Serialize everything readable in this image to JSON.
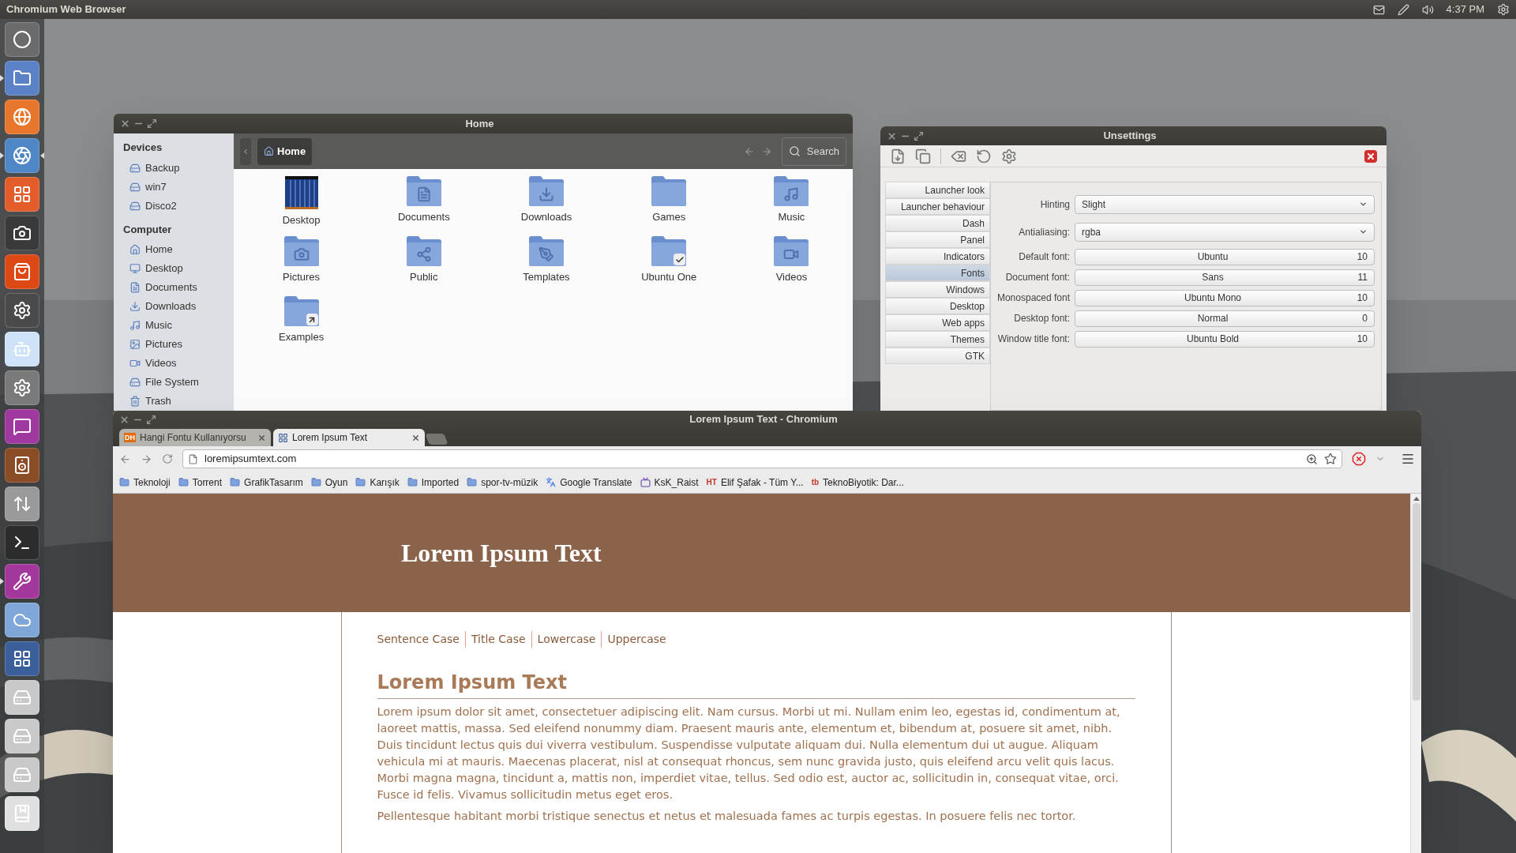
{
  "top_panel": {
    "title": "Chromium Web Browser",
    "clock": "4:37 PM"
  },
  "launcher": [
    {
      "kind": "dash",
      "running": false,
      "focused": false
    },
    {
      "kind": "files",
      "running": true,
      "focused": false
    },
    {
      "kind": "firefox",
      "running": false,
      "focused": false
    },
    {
      "kind": "chromium",
      "running": true,
      "focused": true
    },
    {
      "kind": "office",
      "running": false,
      "focused": false
    },
    {
      "kind": "camera",
      "running": false,
      "focused": false
    },
    {
      "kind": "software",
      "running": false,
      "focused": false
    },
    {
      "kind": "system",
      "running": false,
      "focused": false
    },
    {
      "kind": "reddit",
      "running": false,
      "focused": false
    },
    {
      "kind": "gear",
      "running": false,
      "focused": false
    },
    {
      "kind": "chat",
      "running": false,
      "focused": false
    },
    {
      "kind": "speaker",
      "running": false,
      "focused": false
    },
    {
      "kind": "updater",
      "running": false,
      "focused": false
    },
    {
      "kind": "terminal",
      "running": false,
      "focused": false
    },
    {
      "kind": "tweak",
      "running": true,
      "focused": false
    },
    {
      "kind": "cloud",
      "running": false,
      "focused": false
    },
    {
      "kind": "workspaces",
      "running": false,
      "focused": false
    },
    {
      "kind": "drive",
      "running": false,
      "focused": false
    },
    {
      "kind": "drive",
      "running": false,
      "focused": false
    },
    {
      "kind": "drive",
      "running": false,
      "focused": false
    },
    {
      "kind": "reader",
      "running": false,
      "focused": false
    }
  ],
  "file_manager": {
    "title": "Home",
    "path": "Home",
    "search": "Search",
    "sidebar": [
      {
        "heading": "Devices",
        "items": [
          {
            "label": "Backup",
            "kind": "drive"
          },
          {
            "label": "win7",
            "kind": "drive"
          },
          {
            "label": "Disco2",
            "kind": "drive"
          }
        ]
      },
      {
        "heading": "Computer",
        "items": [
          {
            "label": "Home",
            "kind": "home"
          },
          {
            "label": "Desktop",
            "kind": "desktop"
          },
          {
            "label": "Documents",
            "kind": "documents"
          },
          {
            "label": "Downloads",
            "kind": "downloads"
          },
          {
            "label": "Music",
            "kind": "music"
          },
          {
            "label": "Pictures",
            "kind": "pictures"
          },
          {
            "label": "Videos",
            "kind": "videos"
          },
          {
            "label": "File System",
            "kind": "filesystem"
          },
          {
            "label": "Trash",
            "kind": "trash"
          }
        ]
      }
    ],
    "items": [
      {
        "label": "Desktop",
        "kind": "desktop"
      },
      {
        "label": "Documents",
        "kind": "documents"
      },
      {
        "label": "Downloads",
        "kind": "downloads"
      },
      {
        "label": "Games",
        "kind": "plain"
      },
      {
        "label": "Music",
        "kind": "music"
      },
      {
        "label": "Pictures",
        "kind": "pictures"
      },
      {
        "label": "Public",
        "kind": "public"
      },
      {
        "label": "Templates",
        "kind": "templates"
      },
      {
        "label": "Ubuntu One",
        "kind": "ubuntuone"
      },
      {
        "label": "Videos",
        "kind": "videos"
      },
      {
        "label": "Examples",
        "kind": "link"
      }
    ]
  },
  "unsettings": {
    "title": "Unsettings",
    "tabs": [
      {
        "label": "Launcher look",
        "selected": false
      },
      {
        "label": "Launcher behaviour",
        "selected": false
      },
      {
        "label": "Dash",
        "selected": false
      },
      {
        "label": "Panel",
        "selected": false
      },
      {
        "label": "Indicators",
        "selected": false
      },
      {
        "label": "Fonts",
        "selected": true
      },
      {
        "label": "Windows",
        "selected": false
      },
      {
        "label": "Desktop",
        "selected": false
      },
      {
        "label": "Web apps",
        "selected": false
      },
      {
        "label": "Themes",
        "selected": false
      },
      {
        "label": "GTK",
        "selected": false
      }
    ],
    "fields": [
      {
        "kind": "dropdown",
        "label": "Hinting",
        "value": "Slight"
      },
      {
        "kind": "dropdown",
        "label": "Antialiasing:",
        "value": "rgba"
      },
      {
        "kind": "font",
        "label": "Default font:",
        "value": "Ubuntu",
        "size": "10"
      },
      {
        "kind": "font",
        "label": "Document font:",
        "value": "Sans",
        "size": "11"
      },
      {
        "kind": "font",
        "label": "Monospaced font",
        "value": "Ubuntu Mono",
        "size": "10"
      },
      {
        "kind": "font",
        "label": "Desktop font:",
        "value": "Normal",
        "size": "0"
      },
      {
        "kind": "font",
        "label": "Window title font:",
        "value": "Ubuntu Bold",
        "size": "10"
      }
    ]
  },
  "browser": {
    "title": "Lorem Ipsum Text - Chromium",
    "tabs": [
      {
        "label": "Hangi Fontu Kullanıyorsu",
        "favicon_text": "DH",
        "selected": false
      },
      {
        "label": "Lorem Ipsum Text",
        "selected": true
      }
    ],
    "url": "loremipsumtext.com",
    "bookmarks": [
      {
        "label": "Teknoloji",
        "kind": "folder"
      },
      {
        "label": "Torrent",
        "kind": "folder"
      },
      {
        "label": "GrafikTasarım",
        "kind": "folder"
      },
      {
        "label": "Oyun",
        "kind": "folder"
      },
      {
        "label": "Karışık",
        "kind": "folder"
      },
      {
        "label": "Imported",
        "kind": "folder"
      },
      {
        "label": "spor-tv-müzik",
        "kind": "folder"
      },
      {
        "label": "Google Translate",
        "kind": "translate"
      },
      {
        "label": "KsK_Raist",
        "kind": "twitch"
      },
      {
        "label": "Elif Şafak - Tüm Y...",
        "kind": "text",
        "favicon_text": "HT"
      },
      {
        "label": "TeknoBiyotik: Dar...",
        "kind": "text",
        "favicon_text": "tb"
      }
    ],
    "page": {
      "banner_title": "Lorem Ipsum Text",
      "nav": [
        "Sentence Case",
        "Title Case",
        "Lowercase",
        "Uppercase"
      ],
      "heading": "Lorem Ipsum Text",
      "paragraphs": [
        "Lorem ipsum dolor sit amet, consectetuer adipiscing elit. Nam cursus. Morbi ut mi. Nullam enim leo, egestas id, condimentum at, laoreet mattis, massa. Sed eleifend nonummy diam. Praesent mauris ante, elementum et, bibendum at, posuere sit amet, nibh. Duis tincidunt lectus quis dui viverra vestibulum. Suspendisse vulputate aliquam dui. Nulla elementum dui ut augue. Aliquam vehicula mi at mauris. Maecenas placerat, nisl at consequat rhoncus, sem nunc gravida justo, quis eleifend arcu velit quis lacus. Morbi magna magna, tincidunt a, mattis non, imperdiet vitae, tellus. Sed odio est, auctor ac, sollicitudin in, consequat vitae, orci. Fusce id felis. Vivamus sollicitudin metus eget eros.",
        "Pellentesque habitant morbi tristique senectus et netus et malesuada fames ac turpis egestas. In posuere felis nec tortor."
      ]
    }
  }
}
